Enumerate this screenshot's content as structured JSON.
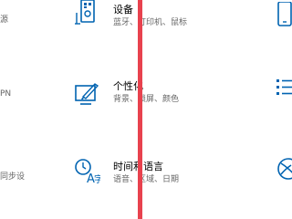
{
  "left_column": {
    "items": [
      "源",
      "PN",
      "同步设"
    ]
  },
  "tiles": [
    {
      "title": "设备",
      "desc": "蓝牙、打印机、鼠标",
      "icon": "devices-icon"
    },
    {
      "title": "个性化",
      "desc": "背景、锁屏、颜色",
      "icon": "personalization-icon"
    },
    {
      "title": "时间和语言",
      "desc": "语音、区域、日期",
      "icon": "time-language-icon"
    }
  ],
  "colors": {
    "accent": "#0063b1",
    "annotation_line": "#e8424e",
    "secondary_text": "#666666"
  }
}
